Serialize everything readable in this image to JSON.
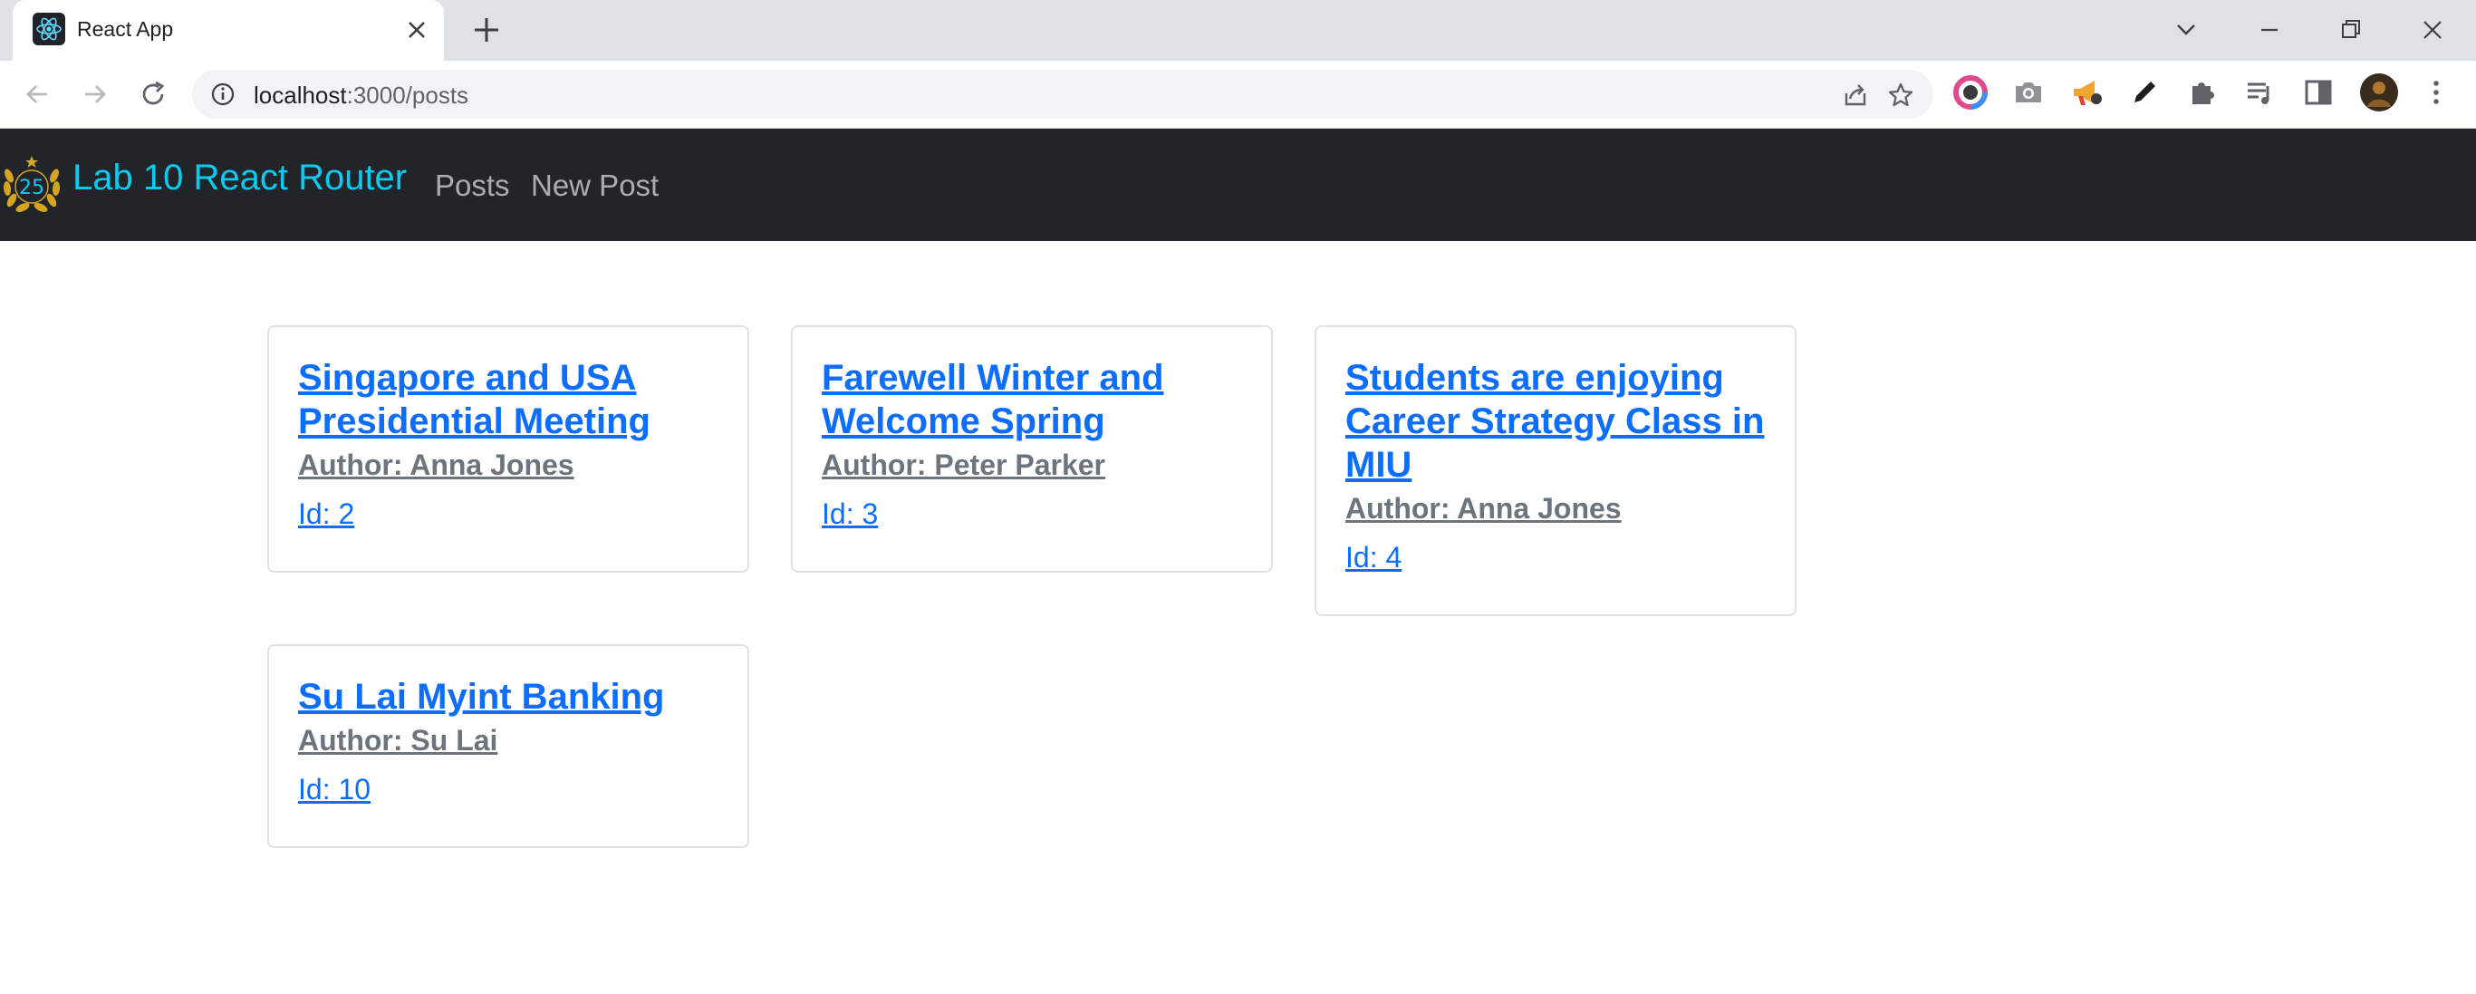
{
  "browser": {
    "tab_title": "React App",
    "url_host": "localhost",
    "url_path": ":3000/posts",
    "icons": {
      "favicon": "react-logo-icon",
      "tab_close": "close-icon",
      "new_tab": "plus-icon",
      "back": "arrow-left-icon",
      "forward": "arrow-right-icon",
      "reload": "reload-icon",
      "site_info": "info-icon",
      "share": "share-icon",
      "bookmark": "star-icon"
    }
  },
  "navbar": {
    "brand": "Lab 10 React Router",
    "logo_text": "25",
    "links": [
      "Posts",
      "New Post"
    ],
    "colors": {
      "background": "#212529",
      "brand": "#0dcaf0"
    }
  },
  "posts": [
    {
      "title": "Singapore and USA\nPresidential Meeting",
      "author": "Author: Anna Jones",
      "id": "Id: 2"
    },
    {
      "title": "Farewell Winter and\nWelcome Spring",
      "author": "Author: Peter Parker",
      "id": "Id: 3"
    },
    {
      "title": "Students are enjoying\nCareer Strategy Class in\nMIU",
      "author": "Author: Anna Jones",
      "id": "Id: 4"
    },
    {
      "title": "Su Lai Myint Banking",
      "author": "Author: Su Lai",
      "id": "Id: 10"
    }
  ]
}
